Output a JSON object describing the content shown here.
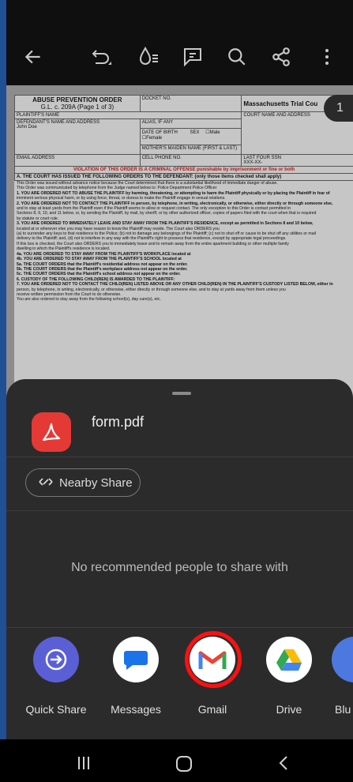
{
  "toolbar": {
    "back_icon": "arrow-left-icon",
    "undo_icon": "undo-icon",
    "ink_icon": "ink-drop-icon",
    "comment_icon": "comment-icon",
    "search_icon": "search-icon",
    "share_icon": "share-icon",
    "more_icon": "more-vert-icon"
  },
  "page_badge": "1",
  "pdf": {
    "title": "ABUSE PREVENTION ORDER",
    "subtitle": "G.L. c. 209A (Page 1 of 3)",
    "docket_label": "DOCKET NO.",
    "court": "Massachusetts Trial Cou",
    "court_label": "COURT NAME AND ADDRESS",
    "plaintiff_label": "PLAINTIFF'S NAME",
    "defendant_label": "DEFENDANT'S NAME AND ADDRESS",
    "defendant_name": "John Doe",
    "alias_label": "ALIAS, IF ANY",
    "dob_label": "DATE OF BIRTH",
    "sex_label": "SEX",
    "sex_male": "Male",
    "sex_female": "Female",
    "mother_label": "MOTHER'S MAIDEN NAME (FIRST & LAST)",
    "email_label": "EMAIL ADDRESS",
    "cell_label": "CELL PHONE NO.",
    "ssn_label": "LAST FOUR SSN",
    "ssn_value": "XXX-XX-",
    "violation": "VIOLATION OF THIS ORDER IS A CRIMINAL OFFENSE punishable by imprisonment or fine or both",
    "issued": "A. THE COURT HAS ISSUED THE FOLLOWING ORDERS TO THE DEFENDANT: (only those items checked shall apply)",
    "lines": [
      "This Order was issued without advance notice because the Court determined that there is a substantial likelihood of immediate danger of abuse.",
      "This Order was communicated by telephone from the Judge named below to: Police Department                          Police Officer",
      "1. YOU ARE ORDERED NOT TO ABUSE THE PLAINTIFF by harming, threatening, or attempting to harm the Plaintiff physically or by placing the Plaintiff in fear of",
      "imminent serious physical harm, or by using force, threat, or duress to make the Plaintiff engage in sexual relations.",
      "2. YOU ARE ORDERED NOT TO CONTACT THE PLAINTIFF in person, by telephone, in writing, electronically, or otherwise, either directly or through someone else,",
      "and to stay at least            yards from the Plaintiff even if the Plaintiff seems to allow or request contact. The only exception to this Order is contact permitted in",
      "Sections 8, 9, 10, and 11 below, or, by sending the Plaintiff, by mail, by sheriff, or by other authorized officer, copies of papers filed with the court when that is required",
      "by statute or court rule.",
      "3. YOU ARE ORDERED TO IMMEDIATELY LEAVE AND STAY AWAY FROM THE PLAINTIFF'S RESIDENCE, except as permitted in Sections 8 and 10 below,",
      "located at                                    or wherever else you may have reason to know the Plaintiff may reside. The Court also ORDERS you",
      "(a) to surrender any keys to that residence to the Police; (b) not to damage any belongings of the Plaintiff; (c) not to shut off or cause to be shut off any utilities or mail",
      "delivery to the Plaintiff; and, (d) not to interfere in any way with the Plaintiff's right to possess that residence, except by appropriate legal proceedings.",
      "If this box is checked, the Court also ORDERS you to immediately leave and to remain away from the entire apartment building or other multiple family",
      "dwelling in which the Plaintiff's residence is located.",
      "4a. YOU ARE ORDERED TO STAY AWAY FROM THE PLAINTIFF'S WORKPLACE located at",
      "4b. YOU ARE ORDERED TO STAY AWAY FROM THE PLAINTIFF'S SCHOOL located at",
      "5a. THE COURT ORDERS that the Plaintiff's residential address not appear on the order.",
      "5b. THE COURT ORDERS that the Plaintiff's workplace address not appear on the order.",
      "5c. THE COURT ORDERS that the Plaintiff's school address not appear on the order.",
      "6. CUSTODY OF THE FOLLOWING CHILD(REN) IS AWARDED TO THE PLAINTIFF:",
      "7. YOU ARE ORDERED NOT TO CONTACT THE CHILD(REN) LISTED ABOVE OR ANY OTHER CHILD(REN) IN THE PLAINTIFF'S CUSTODY LISTED BELOW, either in",
      "person, by telephone, in writing, electronically, or otherwise, either directly or through someone else, and to stay at                yards away from them unless you",
      "receive written permission from the Court to do otherwise.",
      "You are also ordered to stay away from the following school(s), day care(s), etc."
    ]
  },
  "sheet": {
    "file_icon": "pdf-file-icon",
    "file_name": "form.pdf",
    "nearby_icon": "nearby-share-icon",
    "nearby_label": "Nearby Share",
    "no_recommend": "No recommended people to share with",
    "apps": [
      {
        "label": "Quick Share",
        "icon": "quick-share-icon",
        "color": "#5b5fd6"
      },
      {
        "label": "Messages",
        "icon": "messages-icon",
        "color": "#ffffff"
      },
      {
        "label": "Gmail",
        "icon": "gmail-icon",
        "color": "#ffffff"
      },
      {
        "label": "Drive",
        "icon": "drive-icon",
        "color": "#ffffff"
      },
      {
        "label": "Blu",
        "icon": "bluetooth-icon",
        "color": "#4d78e0"
      }
    ]
  },
  "navbar": {
    "recent_icon": "recent-apps-icon",
    "home_icon": "home-icon",
    "back_icon": "back-icon"
  }
}
